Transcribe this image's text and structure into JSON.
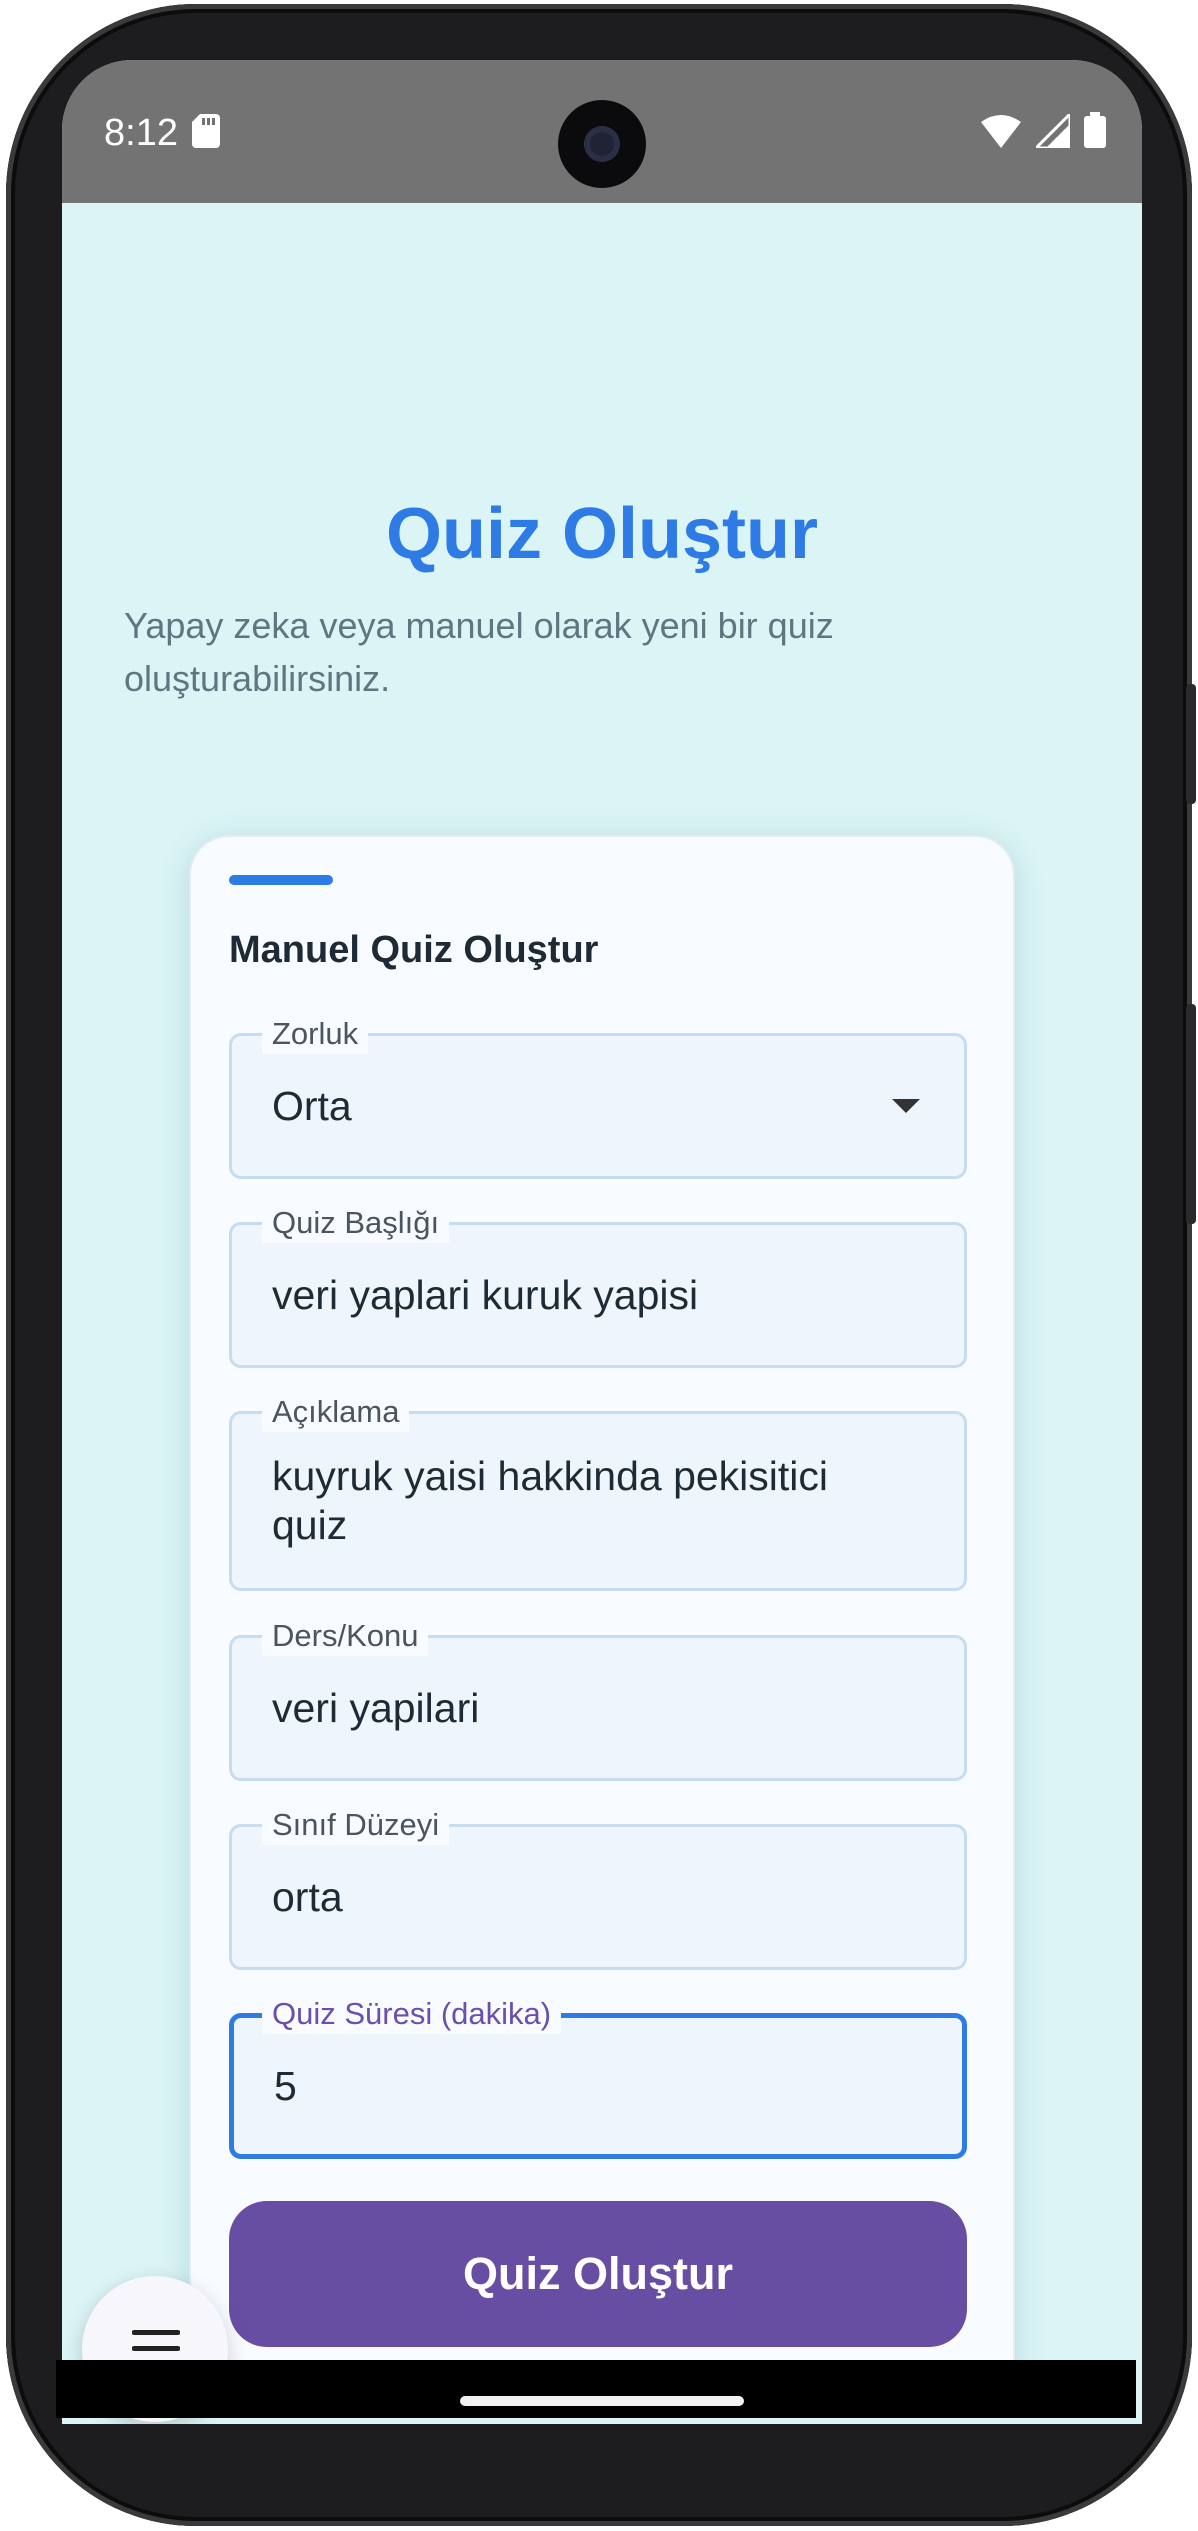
{
  "status_bar": {
    "time": "8:12",
    "icons": [
      "sd-card-icon",
      "wifi-icon",
      "signal-icon",
      "battery-icon"
    ]
  },
  "header": {
    "title": "Quiz Oluştur",
    "subtitle": "Yapay zeka veya manuel olarak yeni bir quiz oluşturabilirsiniz."
  },
  "form": {
    "title": "Manuel Quiz Oluştur",
    "difficulty": {
      "label": "Zorluk",
      "value": "Orta"
    },
    "quiz_title": {
      "label": "Quiz Başlığı",
      "value": "veri yaplari kuruk yapisi"
    },
    "description": {
      "label": "Açıklama",
      "value": "kuyruk yaisi hakkinda pekisitici quiz"
    },
    "subject": {
      "label": "Ders/Konu",
      "value": "veri yapilari"
    },
    "grade_level": {
      "label": "Sınıf Düzeyi",
      "value": "orta"
    },
    "duration": {
      "label": "Quiz Süresi (dakika)",
      "value": "5"
    },
    "submit_label": "Quiz Oluştur"
  },
  "colors": {
    "accent": "#2e7be6",
    "button": "#674ea3",
    "background": "#dbf4f6"
  }
}
